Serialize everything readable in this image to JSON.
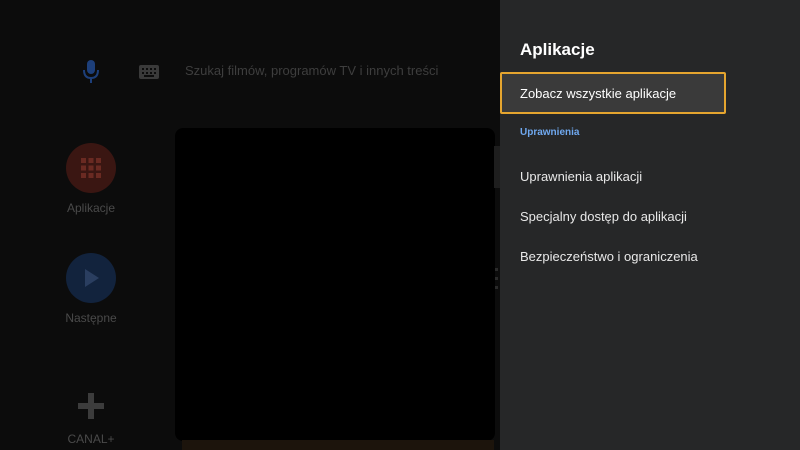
{
  "home": {
    "search_placeholder": "Szukaj filmów, programów TV i innych treści",
    "apps": [
      {
        "label": "Aplikacje",
        "icon": "grid-icon"
      },
      {
        "label": "Następne",
        "icon": "play-icon"
      },
      {
        "label": "CANAL+",
        "icon": "plus-icon"
      }
    ]
  },
  "panel": {
    "title": "Aplikacje",
    "focused_item": "Zobacz wszystkie aplikacje",
    "section_header": "Uprawnienia",
    "items": [
      "Uprawnienia aplikacji",
      "Specjalny dostęp do aplikacji",
      "Bezpieczeństwo i ograniczenia"
    ]
  },
  "colors": {
    "panel_bg": "#262728",
    "focus_border": "#e5a52f",
    "section_header": "#6fa8ef"
  }
}
